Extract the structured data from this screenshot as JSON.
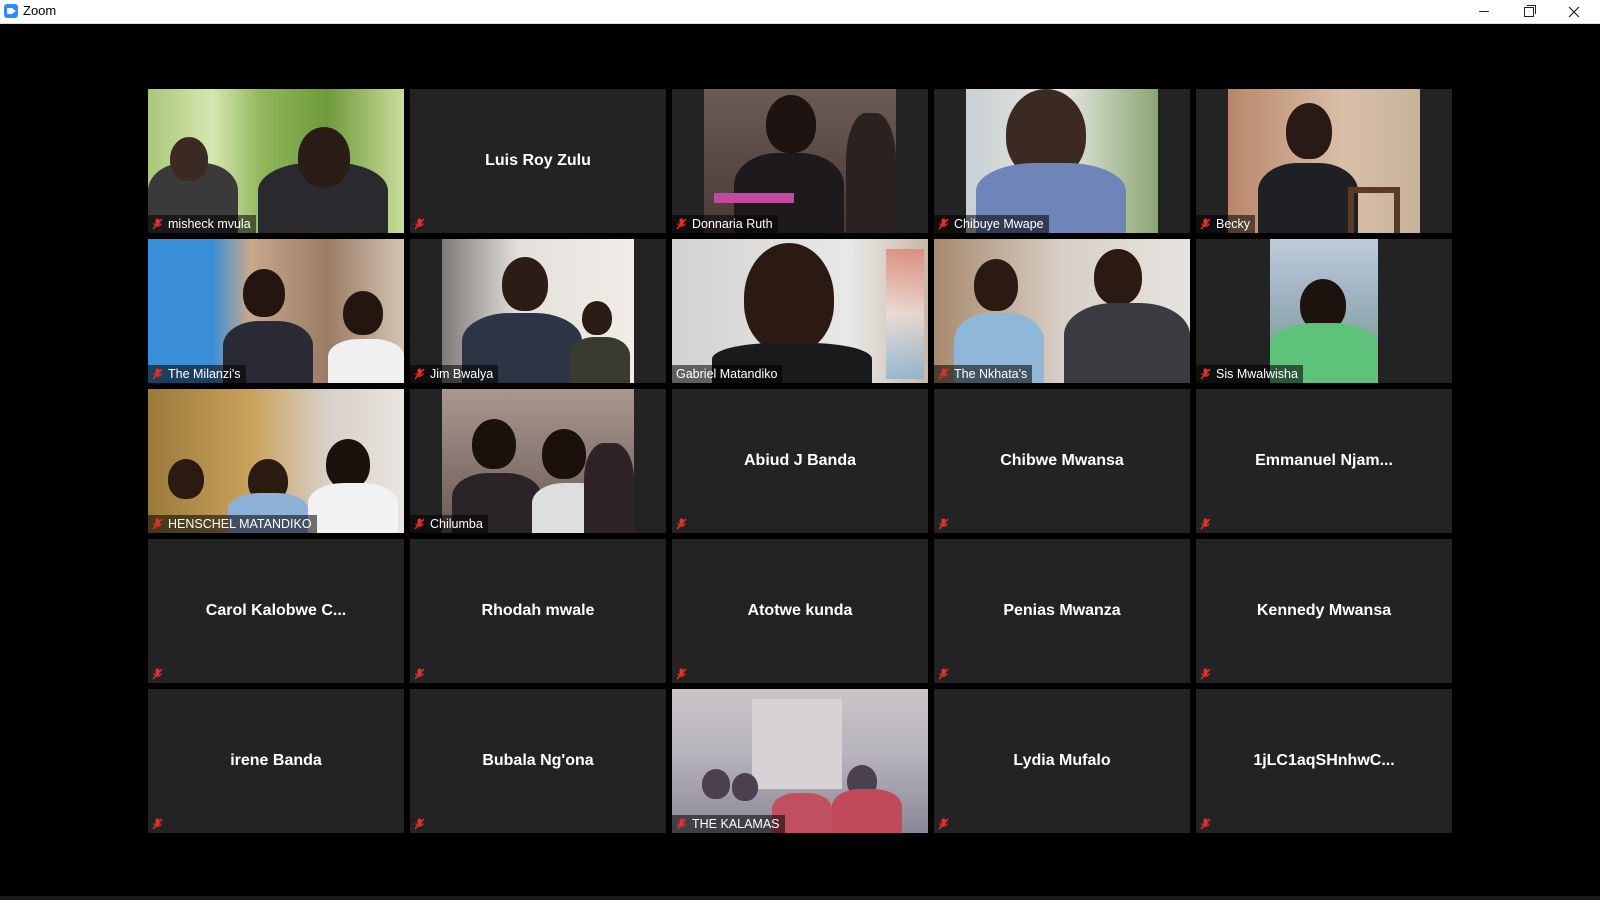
{
  "window": {
    "title": "Zoom",
    "accent": "#2d8cff",
    "active_speaker_border": "#c8df47"
  },
  "participants": [
    {
      "name": "misheck mvula",
      "video": true,
      "muted": true
    },
    {
      "name": "Luis Roy Zulu",
      "video": false,
      "muted": true
    },
    {
      "name": "Donnaria Ruth",
      "video": true,
      "muted": true
    },
    {
      "name": "Chibuye Mwape",
      "video": true,
      "muted": true
    },
    {
      "name": "Becky",
      "video": true,
      "muted": true
    },
    {
      "name": "The Milanzi's",
      "video": true,
      "muted": true
    },
    {
      "name": "Jim Bwalya",
      "video": true,
      "muted": true
    },
    {
      "name": "Gabriel Matandiko",
      "video": true,
      "muted": false,
      "active": true
    },
    {
      "name": "The Nkhata's",
      "video": true,
      "muted": true
    },
    {
      "name": "Sis Mwalwisha",
      "video": true,
      "muted": true
    },
    {
      "name": "HENSCHEL MATANDIKO",
      "video": true,
      "muted": true
    },
    {
      "name": "Chilumba",
      "video": true,
      "muted": true
    },
    {
      "name": "Abiud J Banda",
      "video": false,
      "muted": true
    },
    {
      "name": "Chibwe Mwansa",
      "video": false,
      "muted": true
    },
    {
      "name": "Emmanuel  Njam...",
      "video": false,
      "muted": true
    },
    {
      "name": "Carol Kalobwe C...",
      "video": false,
      "muted": true
    },
    {
      "name": "Rhodah mwale",
      "video": false,
      "muted": true
    },
    {
      "name": "Atotwe kunda",
      "video": false,
      "muted": true
    },
    {
      "name": "Penias Mwanza",
      "video": false,
      "muted": true
    },
    {
      "name": "Kennedy Mwansa",
      "video": false,
      "muted": true
    },
    {
      "name": "irene Banda",
      "video": false,
      "muted": true
    },
    {
      "name": "Bubala Ng'ona",
      "video": false,
      "muted": true
    },
    {
      "name": "THE KALAMAS",
      "video": true,
      "muted": true
    },
    {
      "name": "Lydia Mufalo",
      "video": false,
      "muted": true
    },
    {
      "name": "1jLC1aqSHnhwC...",
      "video": false,
      "muted": true
    }
  ],
  "icons": {
    "app": "zoom-app-icon",
    "muted": "microphone-muted-icon",
    "minimize": "minimize-icon",
    "restore": "restore-icon",
    "close": "close-icon"
  }
}
